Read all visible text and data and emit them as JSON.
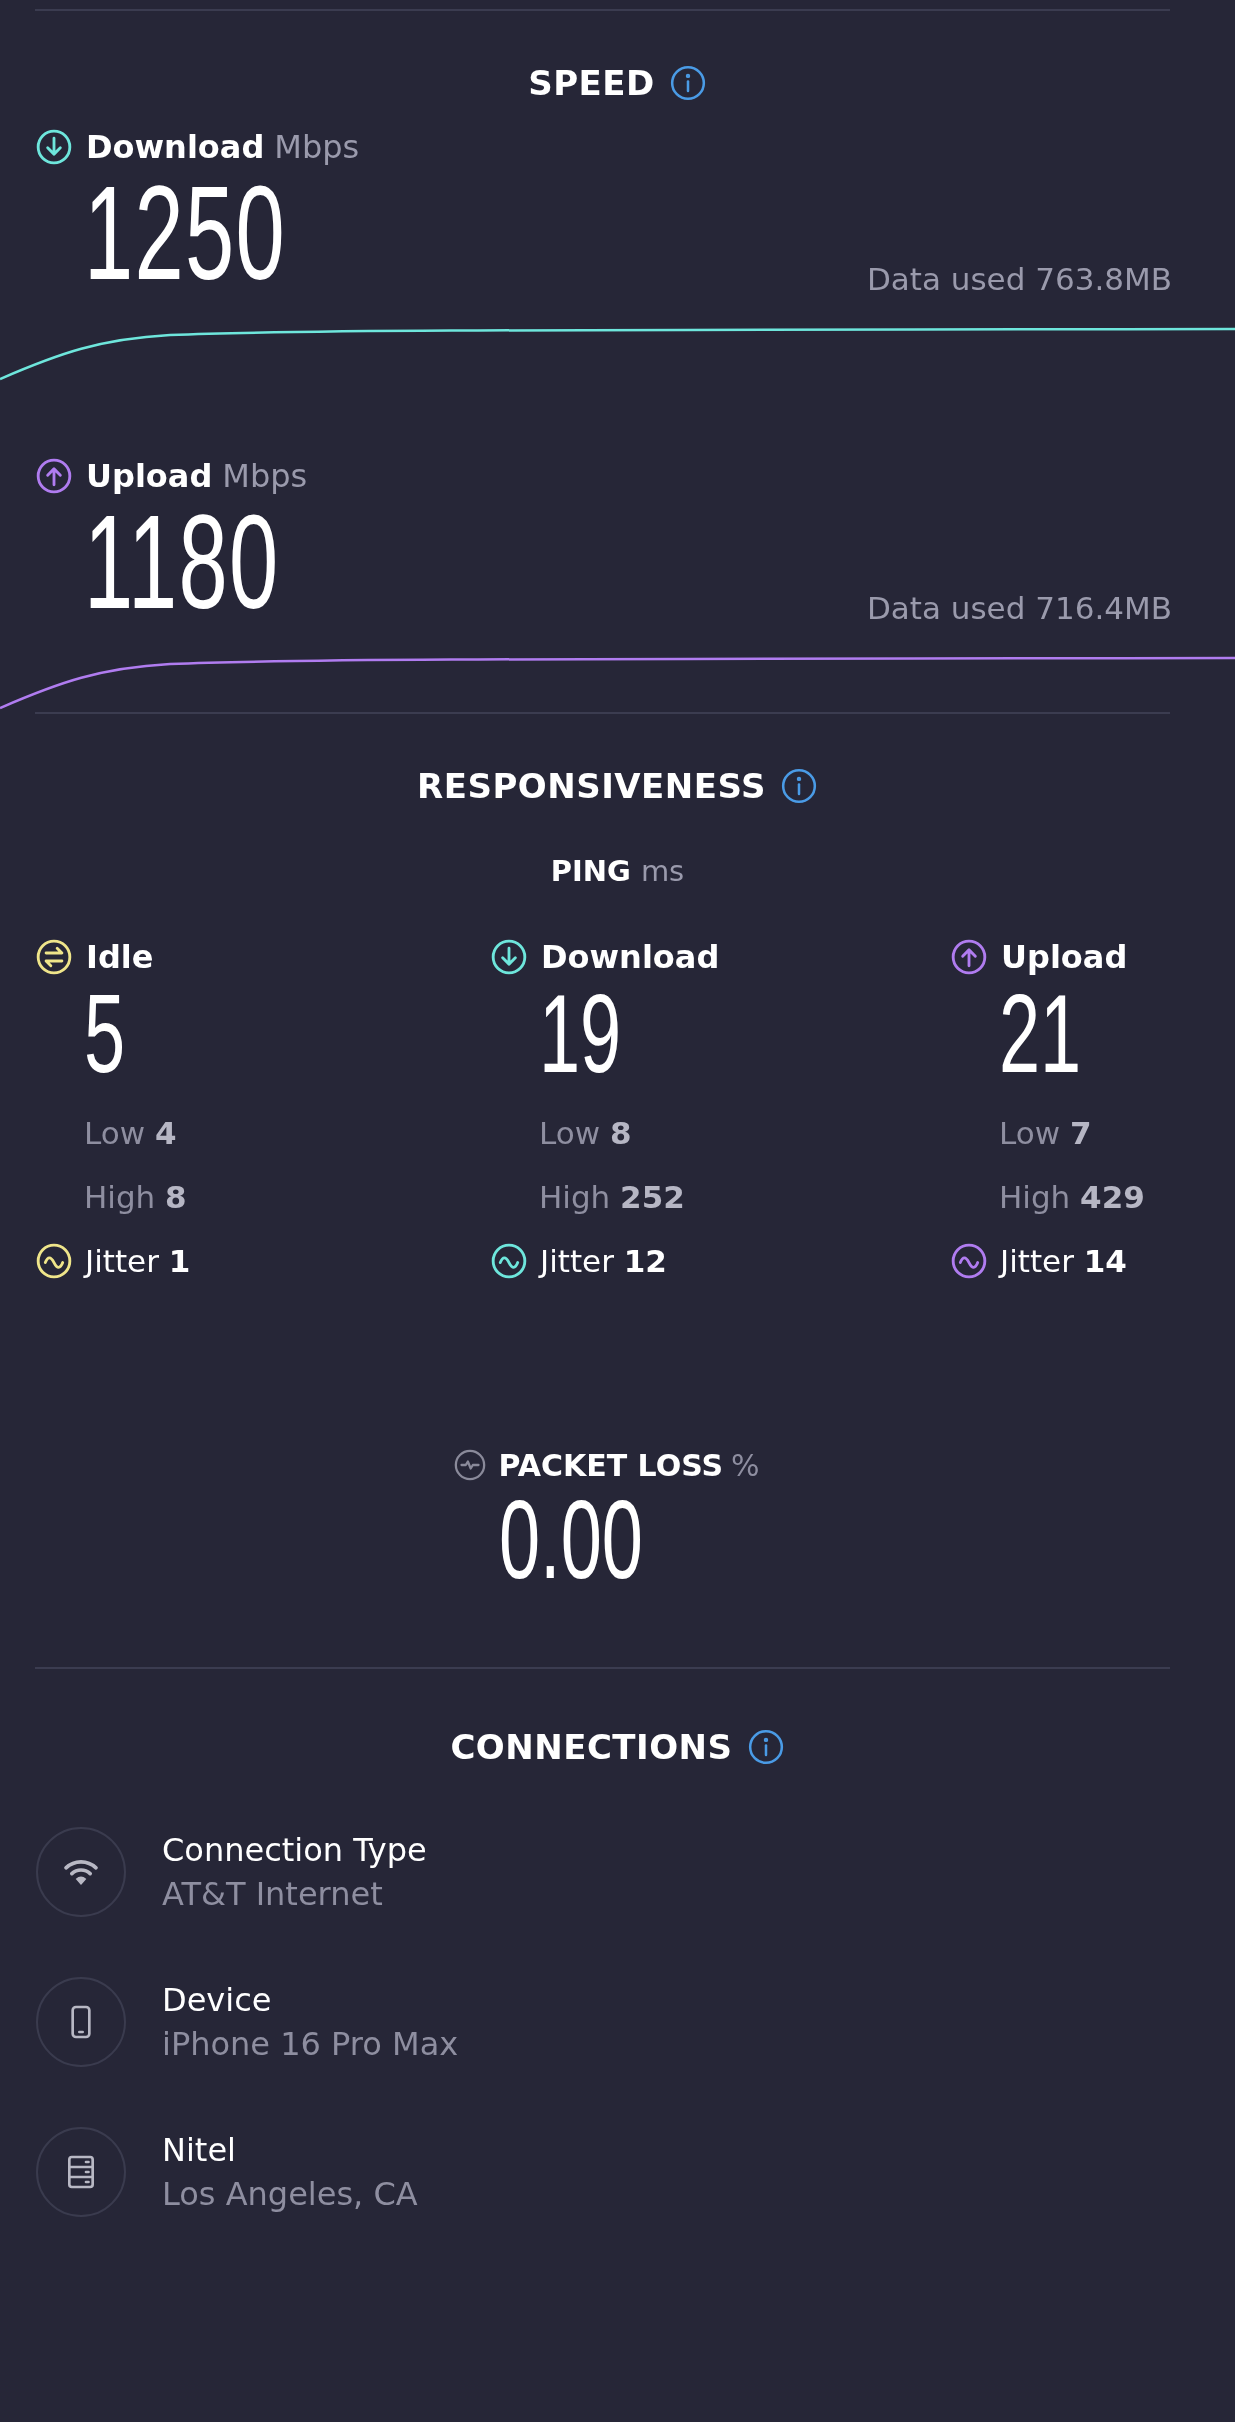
{
  "speed": {
    "title": "SPEED",
    "metrics": [
      {
        "kind": "download",
        "label": "Download",
        "unit": "Mbps",
        "value": "1250",
        "data_used": "Data used 763.8MB",
        "color": "#6ee6dc"
      },
      {
        "kind": "upload",
        "label": "Upload",
        "unit": "Mbps",
        "value": "1180",
        "data_used": "Data used 716.4MB",
        "color": "#b07cf0"
      }
    ]
  },
  "responsiveness": {
    "title": "RESPONSIVENESS",
    "ping_label": "PING",
    "ping_unit": "ms",
    "columns": [
      {
        "kind": "idle",
        "label": "Idle",
        "value": "5",
        "low_label": "Low",
        "low": "4",
        "high_label": "High",
        "high": "8",
        "jitter_label": "Jitter",
        "jitter": "1",
        "color": "#efe58a"
      },
      {
        "kind": "download",
        "label": "Download",
        "value": "19",
        "low_label": "Low",
        "low": "8",
        "high_label": "High",
        "high": "252",
        "jitter_label": "Jitter",
        "jitter": "12",
        "color": "#6ee6dc"
      },
      {
        "kind": "upload",
        "label": "Upload",
        "value": "21",
        "low_label": "Low",
        "low": "7",
        "high_label": "High",
        "high": "429",
        "jitter_label": "Jitter",
        "jitter": "14",
        "color": "#b07cf0"
      }
    ]
  },
  "packet_loss": {
    "label": "PACKET LOSS",
    "unit": "%",
    "value": "0.00"
  },
  "connections": {
    "title": "CONNECTIONS",
    "items": [
      {
        "kind": "wifi",
        "title": "Connection Type",
        "subtitle": "AT&T Internet"
      },
      {
        "kind": "device",
        "title": "Device",
        "subtitle": "iPhone 16 Pro Max"
      },
      {
        "kind": "server",
        "title": "Nitel",
        "subtitle": "Los Angeles, CA"
      }
    ]
  }
}
